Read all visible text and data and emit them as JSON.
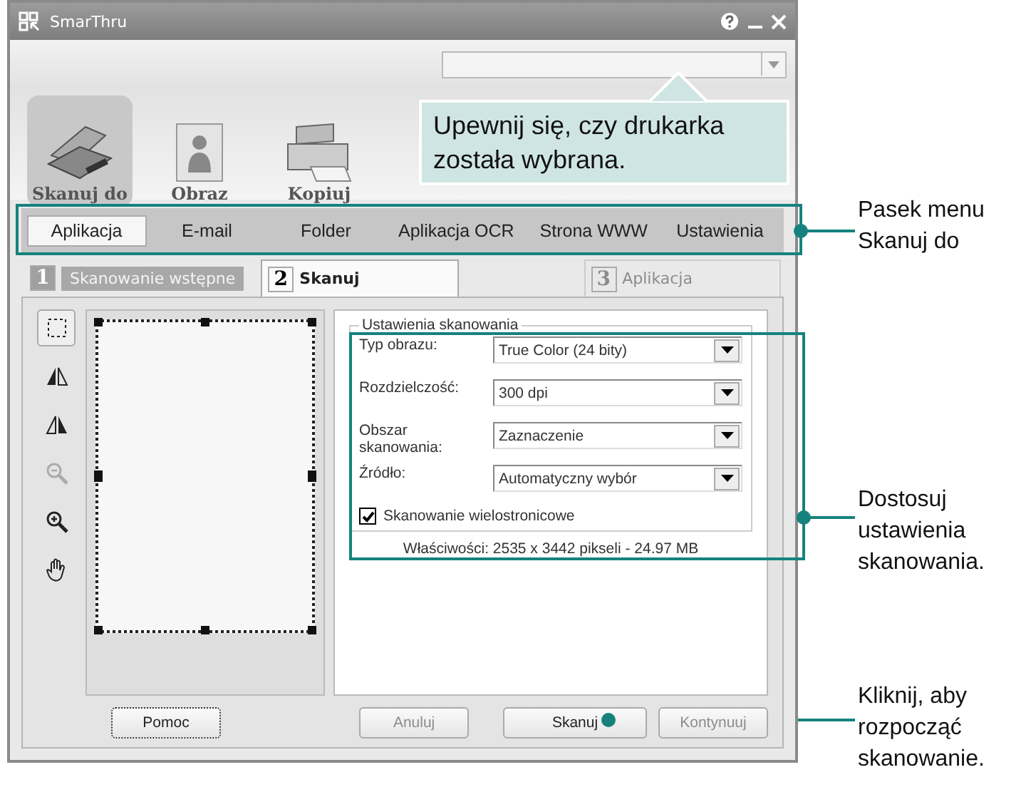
{
  "window": {
    "title": "SmarThru"
  },
  "toolbar": [
    {
      "kind": "scanner",
      "label": "Skanuj do",
      "selected": true
    },
    {
      "kind": "image",
      "label": "Obraz",
      "selected": false
    },
    {
      "kind": "copier",
      "label": "Kopiuj",
      "selected": false
    }
  ],
  "tooltip": {
    "text": "Upewnij się, czy drukarka została wybrana."
  },
  "menu_tabs": [
    {
      "label": "Aplikacja",
      "selected": true
    },
    {
      "label": "E-mail",
      "selected": false
    },
    {
      "label": "Folder",
      "selected": false
    },
    {
      "label": "Aplikacja OCR",
      "selected": false
    },
    {
      "label": "Strona WWW",
      "selected": false
    },
    {
      "label": "Ustawienia",
      "selected": false
    }
  ],
  "steps": [
    {
      "number": "1",
      "label": "Skanowanie wstępne",
      "kind": "done"
    },
    {
      "number": "2",
      "label": "Skanuj",
      "kind": "current"
    },
    {
      "number": "3",
      "label": "Aplikacja",
      "kind": "disabled"
    }
  ],
  "tools": [
    {
      "kind": "select",
      "selected": true,
      "disabled": false
    },
    {
      "kind": "flip",
      "selected": false,
      "disabled": false
    },
    {
      "kind": "mirror",
      "selected": false,
      "disabled": false
    },
    {
      "kind": "zoom-out",
      "selected": false,
      "disabled": true
    },
    {
      "kind": "zoom-in",
      "selected": false,
      "disabled": false
    },
    {
      "kind": "hand",
      "selected": false,
      "disabled": false
    }
  ],
  "settings": {
    "group_title": "Ustawienia skanowania",
    "fields": [
      {
        "label": "Typ obrazu:",
        "value": "True Color (24 bity)"
      },
      {
        "label": "Rozdzielczość:",
        "value": "300 dpi"
      },
      {
        "label": "Obszar skanowania:",
        "value": "Zaznaczenie"
      },
      {
        "label": "Źródło:",
        "value": "Automatyczny wybór"
      }
    ],
    "checkbox": {
      "label": "Skanowanie wielostronicowe",
      "checked": true
    },
    "properties": "Właściwości: 2535 x 3442 pikseli - 24.97 MB"
  },
  "buttons": [
    {
      "label": "Pomoc",
      "disabled": false
    },
    {
      "label": "Anuluj",
      "disabled": true
    },
    {
      "label": "Skanuj",
      "disabled": false
    },
    {
      "label": "Kontynuuj",
      "disabled": true
    }
  ],
  "callouts": [
    {
      "text": "Pasek menu Skanuj do"
    },
    {
      "text": "Dostosuj ustawienia skanowania."
    },
    {
      "text": "Kliknij, aby rozpocząć skanowanie."
    }
  ]
}
